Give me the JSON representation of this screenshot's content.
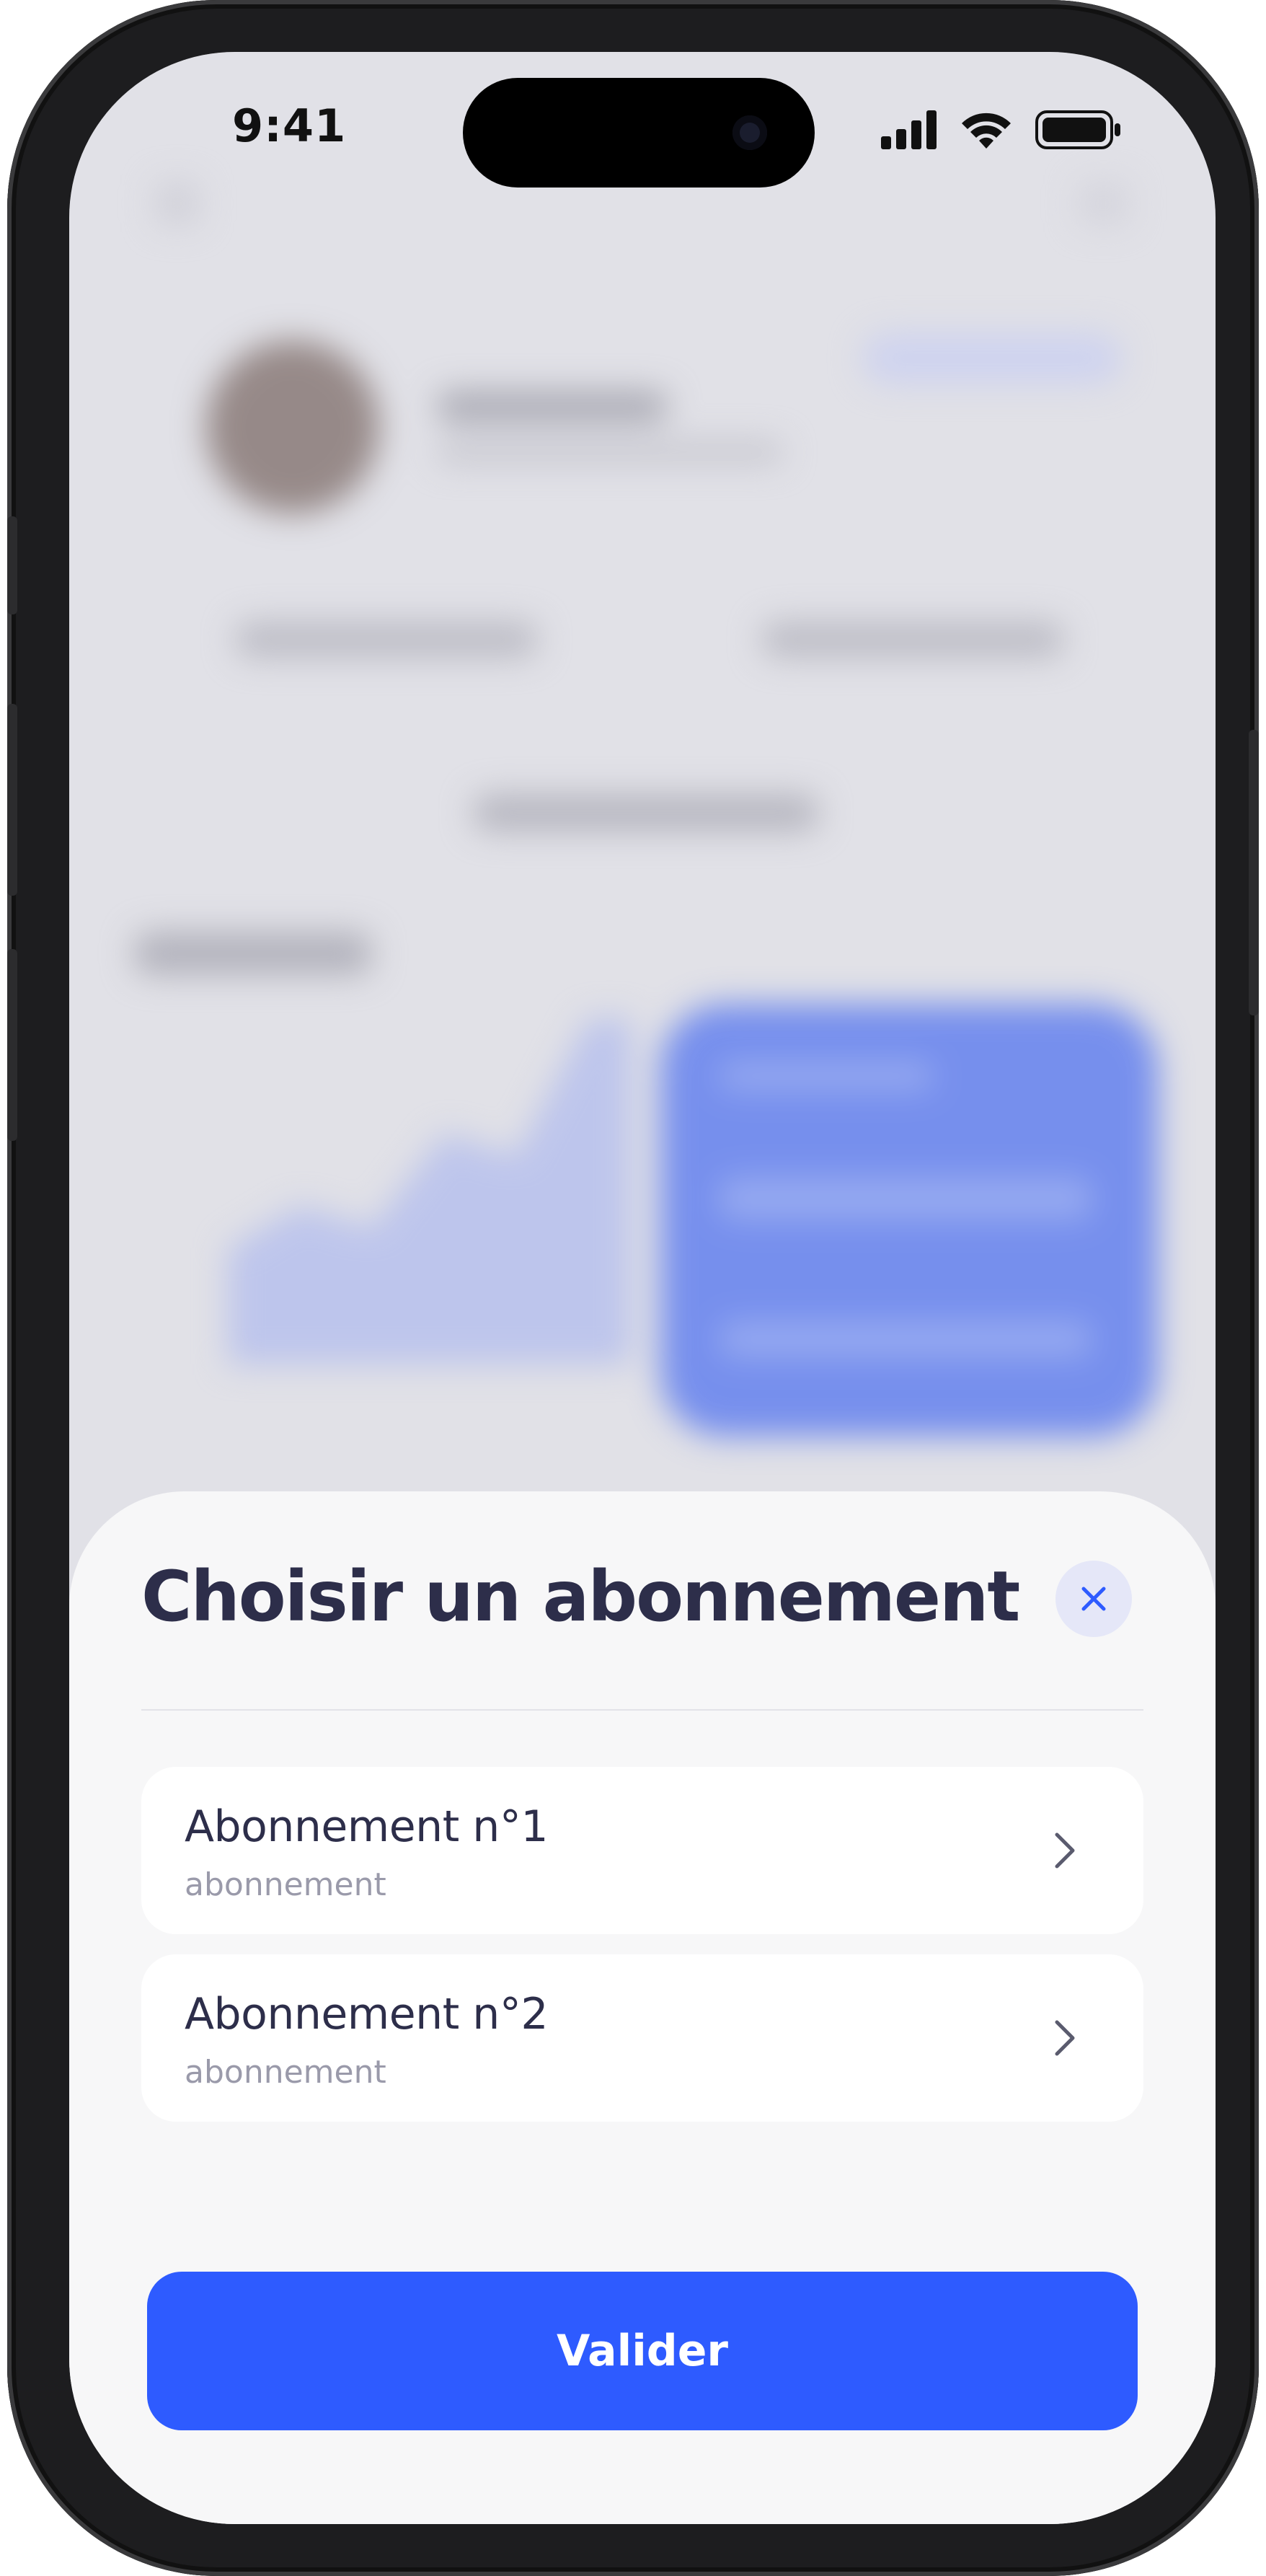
{
  "status_bar": {
    "time": "9:41",
    "icons": [
      "signal-icon",
      "wifi-icon",
      "battery-icon"
    ]
  },
  "sheet": {
    "title": "Choisir un abonnement",
    "close_icon": "close-icon",
    "options": [
      {
        "title": "Abonnement n°1",
        "subtitle": "abonnement"
      },
      {
        "title": "Abonnement n°2",
        "subtitle": "abonnement"
      }
    ],
    "submit_label": "Valider"
  },
  "colors": {
    "accent": "#2e5bff",
    "title": "#2d2e4a",
    "subtitle": "#9a9aaa",
    "sheet_bg": "#f7f7f8"
  }
}
